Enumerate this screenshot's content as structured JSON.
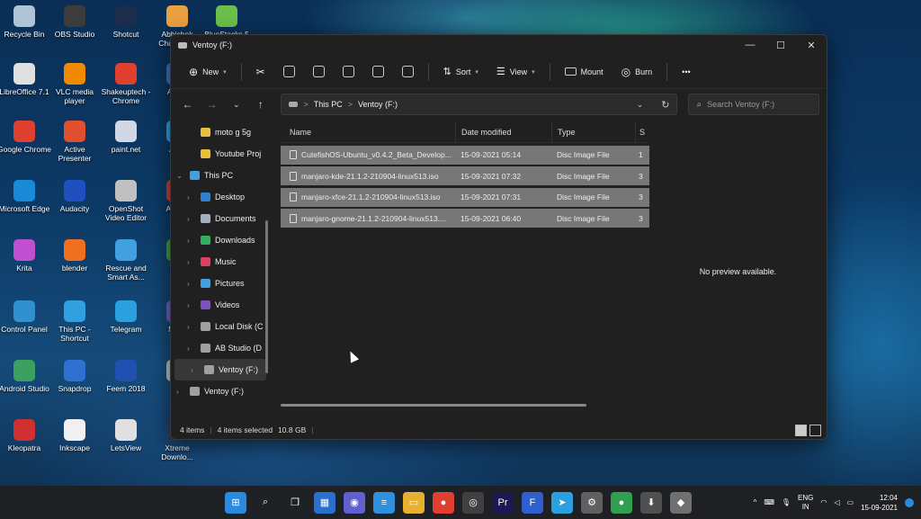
{
  "desktop_icons": [
    {
      "label": "Recycle Bin",
      "color": "#b0c4d8"
    },
    {
      "label": "OBS Studio",
      "color": "#3c3c3c"
    },
    {
      "label": "Shotcut",
      "color": "#1b2d4a"
    },
    {
      "label": "Abhishek Chaudhary",
      "color": "#e8a040"
    },
    {
      "label": "BlueStacks 5",
      "color": "#6ac04a"
    },
    {
      "label": "LibreOffice 7.1",
      "color": "#e0e0e0"
    },
    {
      "label": "VLC media player",
      "color": "#f08a00"
    },
    {
      "label": "Shakeuptech - Chrome",
      "color": "#e04030"
    },
    {
      "label": "AU Cl",
      "color": "#4070c0"
    },
    {
      "label": "Google Chrome",
      "color": "#e04030"
    },
    {
      "label": "Active Presenter",
      "color": "#e05030"
    },
    {
      "label": "paint.net",
      "color": "#d0d8e8"
    },
    {
      "label": "A Ph",
      "color": "#30a0e0"
    },
    {
      "label": "Microsoft Edge",
      "color": "#1a8ad8"
    },
    {
      "label": "Audacity",
      "color": "#2050c0"
    },
    {
      "label": "OpenShot Video Editor",
      "color": "#c0c0c0"
    },
    {
      "label": "A Pres",
      "color": "#c04040"
    },
    {
      "label": "Krita",
      "color": "#c050d0"
    },
    {
      "label": "blender",
      "color": "#f07020"
    },
    {
      "label": "Rescue and Smart As...",
      "color": "#40a0e0"
    },
    {
      "label": "bale",
      "color": "#40a040"
    },
    {
      "label": "Control Panel",
      "color": "#3090d0"
    },
    {
      "label": "This PC - Shortcut",
      "color": "#30a0e0"
    },
    {
      "label": "Telegram",
      "color": "#2aa0e0"
    },
    {
      "label": "M Pa",
      "color": "#7060c0"
    },
    {
      "label": "Android Studio",
      "color": "#3ca060"
    },
    {
      "label": "Snapdrop",
      "color": "#3070d0"
    },
    {
      "label": "Feem 2018",
      "color": "#2050b0"
    },
    {
      "label": "rufu",
      "color": "#c0c0c0"
    },
    {
      "label": "Kleopatra",
      "color": "#d03030"
    },
    {
      "label": "Inkscape",
      "color": "#f0f0f0"
    },
    {
      "label": "LetsView",
      "color": "#e0e0e0"
    },
    {
      "label": "Xtreme Downlo...",
      "color": "#304060"
    }
  ],
  "window": {
    "title": "Ventoy (F:)",
    "controls": {
      "minimize": "—",
      "maximize": "☐",
      "close": "✕"
    }
  },
  "toolbar": {
    "new_label": "New",
    "sort_label": "Sort",
    "view_label": "View",
    "mount_label": "Mount",
    "burn_label": "Burn",
    "more_label": "•••"
  },
  "address": {
    "this_pc": "This PC",
    "sep": ">",
    "current": "Ventoy (F:)",
    "search_placeholder": "Search Ventoy (F:)"
  },
  "nav": {
    "items": [
      {
        "label": "moto g 5g",
        "indent": 1,
        "chev": "",
        "color": "#e8c040"
      },
      {
        "label": "Youtube Proj",
        "indent": 1,
        "chev": "",
        "color": "#e8c040"
      },
      {
        "label": "This PC",
        "indent": 0,
        "chev": "⌄",
        "color": "#40a0e0"
      },
      {
        "label": "Desktop",
        "indent": 1,
        "chev": "›",
        "color": "#3080d0"
      },
      {
        "label": "Documents",
        "indent": 1,
        "chev": "›",
        "color": "#a0b0c0"
      },
      {
        "label": "Downloads",
        "indent": 1,
        "chev": "›",
        "color": "#30b060"
      },
      {
        "label": "Music",
        "indent": 1,
        "chev": "›",
        "color": "#e04060"
      },
      {
        "label": "Pictures",
        "indent": 1,
        "chev": "›",
        "color": "#40a0e0"
      },
      {
        "label": "Videos",
        "indent": 1,
        "chev": "›",
        "color": "#8050c0"
      },
      {
        "label": "Local Disk (C",
        "indent": 1,
        "chev": "›",
        "color": "#a0a0a0"
      },
      {
        "label": "AB Studio (D",
        "indent": 1,
        "chev": "›",
        "color": "#a0a0a0"
      },
      {
        "label": "Ventoy (F:)",
        "indent": 1,
        "chev": "›",
        "color": "#a0a0a0"
      },
      {
        "label": "Ventoy (F:)",
        "indent": 0,
        "chev": "›",
        "color": "#a0a0a0"
      }
    ]
  },
  "files": {
    "columns": {
      "name": "Name",
      "date": "Date modified",
      "type": "Type",
      "size": "S"
    },
    "rows": [
      {
        "name": "CutefishOS-Ubuntu_v0.4.2_Beta_Develop...",
        "date": "15-09-2021 05:14",
        "type": "Disc Image File",
        "size": "1"
      },
      {
        "name": "manjaro-kde-21.1.2-210904-linux513.iso",
        "date": "15-09-2021 07:32",
        "type": "Disc Image File",
        "size": "3"
      },
      {
        "name": "manjaro-xfce-21.1.2-210904-linux513.iso",
        "date": "15-09-2021 07:31",
        "type": "Disc Image File",
        "size": "3"
      },
      {
        "name": "manjaro-gnome-21.1.2-210904-linux513....",
        "date": "15-09-2021 06:40",
        "type": "Disc Image File",
        "size": "3"
      }
    ]
  },
  "preview_text": "No preview available.",
  "status": {
    "items_count": "4 items",
    "selected": "4 items selected",
    "size": "10.8 GB"
  },
  "taskbar": {
    "apps": [
      {
        "name": "start-icon",
        "glyph": "⊞",
        "color": "#2a8ae0"
      },
      {
        "name": "search-icon",
        "glyph": "⌕",
        "color": "transparent"
      },
      {
        "name": "task-view-icon",
        "glyph": "❐",
        "color": "transparent"
      },
      {
        "name": "widgets-icon",
        "glyph": "▦",
        "color": "#2a70d0"
      },
      {
        "name": "teams-chat-icon",
        "glyph": "◉",
        "color": "#6060d0"
      },
      {
        "name": "notepad-icon",
        "glyph": "≡",
        "color": "#3090e0"
      },
      {
        "name": "file-explorer-icon",
        "glyph": "▭",
        "color": "#e8b030"
      },
      {
        "name": "chrome-icon",
        "glyph": "●",
        "color": "#e04030"
      },
      {
        "name": "obs-icon",
        "glyph": "◎",
        "color": "#404040"
      },
      {
        "name": "premiere-icon",
        "glyph": "Pr",
        "color": "#1a1a50"
      },
      {
        "name": "feem-icon",
        "glyph": "F",
        "color": "#3060d0"
      },
      {
        "name": "telegram-icon",
        "glyph": "➤",
        "color": "#2aa0e0"
      },
      {
        "name": "settings-icon",
        "glyph": "⚙",
        "color": "#606060"
      },
      {
        "name": "chrome-profile-icon",
        "glyph": "●",
        "color": "#30a050"
      },
      {
        "name": "download-manager-icon",
        "glyph": "⬇",
        "color": "#505050"
      },
      {
        "name": "virtualbox-icon",
        "glyph": "◆",
        "color": "#707070"
      }
    ],
    "tray": {
      "chevron": "^",
      "lang_top": "ENG",
      "lang_bottom": "IN",
      "time": "12:04",
      "date": "15-09-2021"
    }
  }
}
